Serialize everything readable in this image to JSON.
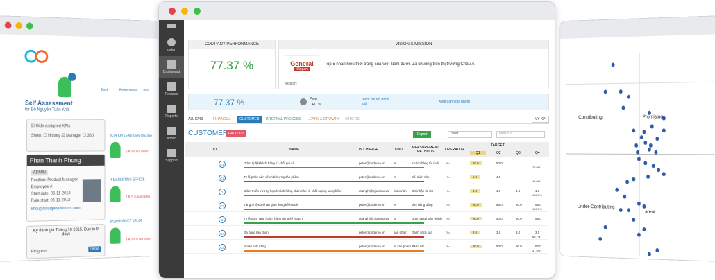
{
  "left": {
    "title": "Self Assessment",
    "subtitle": "for Đỗ Nguyễn Tuấn Khôi",
    "nav": [
      "Back",
      "Performance",
      "Info"
    ],
    "hide_kpis": "Hide assigned KPIs",
    "show": "Show:",
    "history": "History",
    "manager": "Manager",
    "r360": "360",
    "profile_name": "Phan Thanh Phong",
    "admin": "ADMIN",
    "position": "Position: Product Manager",
    "employee": "Employee #:",
    "start": "Start date: 06-11-2013",
    "role_start": "Role start: 06-11-2013",
    "email": "khoi@cloudjetsolutions.com",
    "period": "Kỳ đánh giá Tháng 10 2015, Due in 9 days",
    "progress": "Progress:",
    "detail": "Detail",
    "kpis": [
      {
        "title": "[C] 4 KPI LEAD GEN ONLINE",
        "note": "0 KPIs not rated",
        "tag": "0/4"
      },
      {
        "title": "4 MARKETING EFFICIE",
        "note": "1 KPI is not rated",
        "tag": "0/4"
      },
      {
        "title": "[P] [PRODUCT VELO]",
        "note": "4 KPIs is not rated",
        "tag": "0/4"
      }
    ]
  },
  "main": {
    "sidebar": [
      "peter",
      "Dashboard",
      "Reviews",
      "Reports",
      "Admin",
      "Support"
    ],
    "perf_title": "COMPANY PERFORMANCE",
    "perf_value": "77.37 %",
    "vm_title": "VISION & MISSION",
    "logo": "General",
    "logo_sub": "Slogan",
    "vision": "Top 5 nhãn hiệu thời trang của Việt Nam được ưa chuộng trên thị trường Châu Á",
    "mission": "Mission:",
    "stat_value": "77.37 %",
    "user_name": "Peter",
    "user_role": "CEO %",
    "link1": "Xem chi tiết đánh giá",
    "link2": "Xem đánh giá nhóm",
    "tabs": [
      "ALL KPIS",
      "FINANCIAL",
      "CUSTOMER",
      "INTERNAL PROCESS",
      "LEARN & GROWTH",
      "OTHERS"
    ],
    "my_kpi": "MY KPI",
    "section": "CUSTOMER",
    "add_kpi": "+ ADD KPI",
    "export": "Export",
    "search_user": "peter",
    "search_kpi": "Find KPI...",
    "cols": [
      "ID",
      "NAME",
      "IN CHARGE",
      "UNIT",
      "MEASUREMENT METHODS",
      "OPERATOR",
      "TARGET",
      "Q1",
      "Q2",
      "Q3",
      "Q4"
    ],
    "rows": [
      {
        "id": "C1",
        "name": "Giảm tỷ lệ khách hàng từ chối giá cả",
        "owner": "peter@cjsdemo.vn",
        "unit": "%",
        "method": "Khách hàng từ chối",
        "op": "<=",
        "q": [
          "20.0",
          "50.0",
          "",
          ""
        ],
        "pct": "75.0%"
      },
      {
        "id": "C2",
        "name": "Tỷ lệ phàn nàn về chất lượng sản phẩm",
        "owner": "peter@cjsdemo.vn",
        "unit": "%",
        "method": "Số phàn nàn",
        "op": "<=",
        "q": [
          "5.0",
          "4.0",
          "",
          ""
        ],
        "pct": "46.0%"
      },
      {
        "id": "1",
        "name": "Giảm thiểu trường hợp khách hàng phàn nàn về chất lượng sản phẩm",
        "owner": "dcanphi@cjsdemo.vn",
        "unit": "phàn nàn",
        "method": "Ghi nhận từ CS",
        "op": "<=",
        "q": [
          "1.0",
          "1.0",
          "1.0",
          "1.0"
        ],
        "pct": "130.0%"
      },
      {
        "id": "C3",
        "name": "Tăng tỷ lệ đơn hàn giao đúng kế hoạch",
        "owner": "peter@cjsdemo.vn",
        "unit": "%",
        "method": "đơn hàng đúng",
        "op": ">=",
        "q": [
          "80.0",
          "85.0",
          "90.0",
          "95.0"
        ],
        "pct": "130.0%"
      },
      {
        "id": "1",
        "name": "Tỷ lệ đơn hàng hoàn thành đúng kế hoạch",
        "owner": "dcanphi@cjsdemo.vn",
        "unit": "%",
        "method": "Đơn hàng hoàn thành",
        "op": ">=",
        "q": [
          "80.0",
          "90.0",
          "90.0",
          "95.0"
        ],
        "pct": ""
      },
      {
        "id": "C4",
        "name": "Đa dạng lựa chọn",
        "owner": "peter@cjsdemo.vn",
        "unit": "sản phẩm",
        "method": "Danh sách sản",
        "op": ">=",
        "q": [
          "2.0",
          "3.0",
          "3.0",
          "3.0"
        ],
        "pct": "66.7%"
      },
      {
        "id": "C5",
        "name": "Nhiều tính năng",
        "owner": "peter@cjsdemo.vn",
        "unit": "% sản phẩm đa",
        "method": "Khảo sát",
        "op": ">=",
        "q": [
          "80.0",
          "90.0",
          "90.0",
          "90.0"
        ],
        "pct": "37.5%"
      }
    ]
  },
  "right": {
    "q1": "Contributing",
    "q2": "Promising",
    "q3": "Under-Contributing",
    "q4": "Latent"
  }
}
